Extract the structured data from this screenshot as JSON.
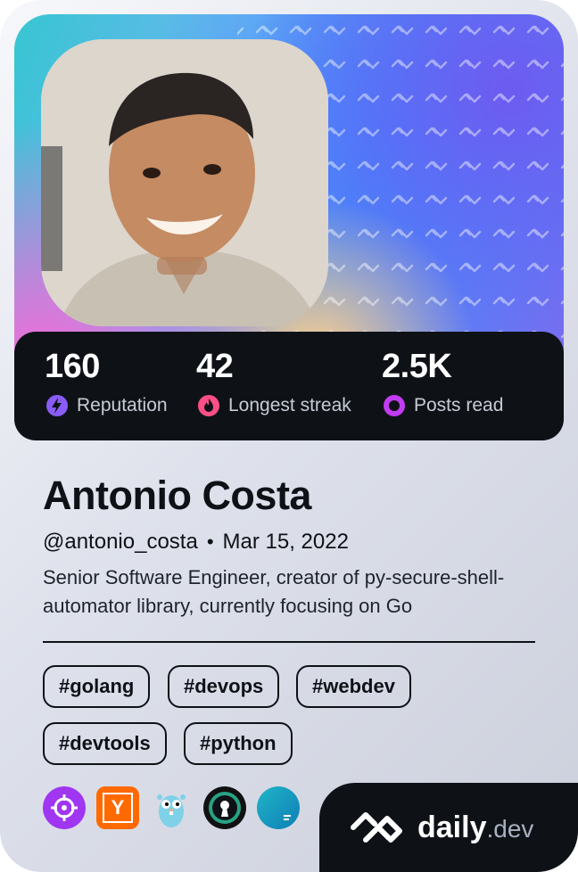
{
  "profile": {
    "name": "Antonio Costa",
    "handle": "@antonio_costa",
    "separator": "•",
    "joined": "Mar 15, 2022",
    "bio": "Senior Software Engineer, creator of py-secure-shell-automator library, currently focusing on Go"
  },
  "stats": [
    {
      "value": "160",
      "label": "Reputation",
      "icon": "lightning-icon",
      "color": "#8a5cf6"
    },
    {
      "value": "42",
      "label": "Longest streak",
      "icon": "flame-icon",
      "color": "#ff4f87"
    },
    {
      "value": "2.5K",
      "label": "Posts read",
      "icon": "eye-ring-icon",
      "color": "#c23cf2"
    }
  ],
  "tags": [
    "#golang",
    "#devops",
    "#webdev",
    "#devtools",
    "#python"
  ],
  "badges": [
    {
      "icon": "crosshair-icon",
      "bg": "#a035f2"
    },
    {
      "icon": "y-letter-icon",
      "letter": "Y",
      "bg": "#ff6a00"
    },
    {
      "icon": "gopher-icon",
      "bg": "#7fd1e8"
    },
    {
      "icon": "keyhole-icon",
      "bg": "#111111"
    },
    {
      "icon": "gradient-circle-icon",
      "bg": "#23b6c9"
    }
  ],
  "brand": {
    "name": "daily",
    "suffix": ".dev"
  }
}
